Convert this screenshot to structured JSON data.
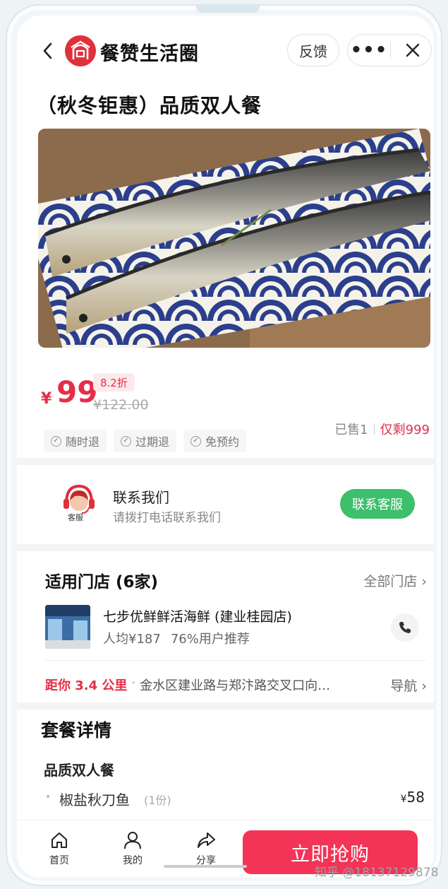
{
  "header": {
    "app_name": "餐赞生活圈",
    "feedback_label": "反馈",
    "more_label": "•••"
  },
  "product": {
    "title": "（秋冬钜惠）品质双人餐",
    "hero_image": "grilled-saury-on-blue-wave-plate"
  },
  "price": {
    "currency": "¥",
    "current": "99",
    "discount": "8.2折",
    "original": "¥122.00"
  },
  "tags": [
    "随时退",
    "过期退",
    "免预约"
  ],
  "sales": {
    "sold": "已售1",
    "remaining": "仅剩999"
  },
  "contact": {
    "avatar_label": "客服",
    "title": "联系我们",
    "subtitle": "请拨打电话联系我们",
    "button": "联系客服"
  },
  "stores": {
    "title": "适用门店 (6家)",
    "all_link": "全部门店",
    "store": {
      "name": "七步优鲜鲜活海鲜 (建业桂园店)",
      "avg_price": "人均¥187",
      "recommend": "76%用户推荐",
      "distance": "距你 3.4 公里",
      "address": "金水区建业路与郑汴路交叉口向…",
      "nav_label": "导航"
    }
  },
  "package": {
    "title": "套餐详情",
    "subtitle": "品质双人餐",
    "items": [
      {
        "name": "椒盐秋刀鱼",
        "qty": "(1份)",
        "currency": "¥",
        "price": "58"
      }
    ]
  },
  "bottom_bar": {
    "home": "首页",
    "mine": "我的",
    "share": "分享",
    "buy": "立即抢购"
  },
  "watermark": "知乎 @18137129878",
  "colors": {
    "accent": "#e62e48",
    "buy_button": "#f33456",
    "contact_button": "#3dbf6b",
    "logo": "#e0303b"
  }
}
